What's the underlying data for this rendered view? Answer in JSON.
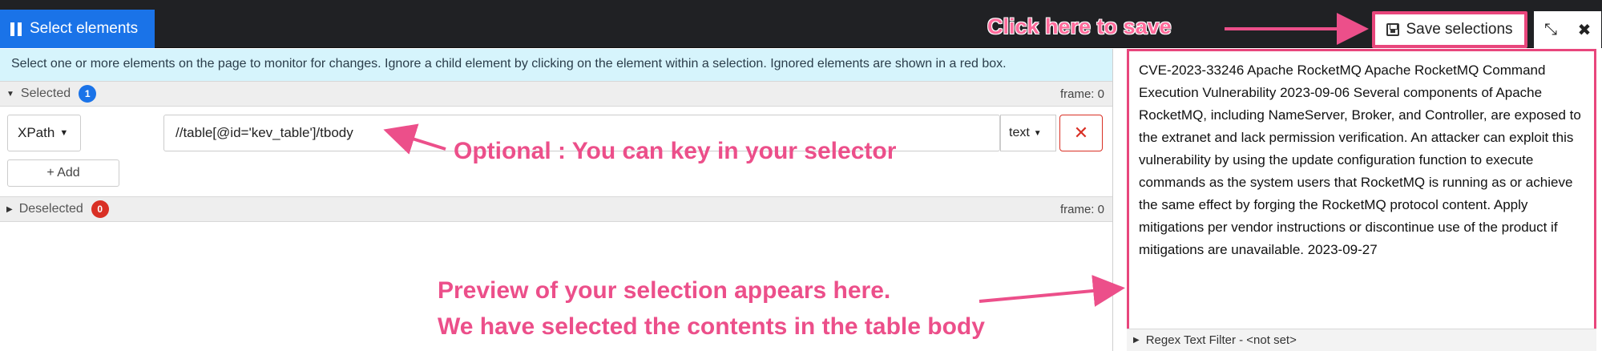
{
  "toolbar": {
    "select_label": "Select elements",
    "save_label": "Save selections",
    "collapse_glyph": "⤡",
    "close_glyph": "✖"
  },
  "info_text": "Select one or more elements on the page to monitor for changes. Ignore a child element by clicking on the element within a selection. Ignored elements are shown in a red box.",
  "selected": {
    "label": "Selected",
    "count": "1",
    "frame": "frame: 0",
    "rows": [
      {
        "type": "XPath",
        "selector": "//table[@id='kev_table']/tbody",
        "mode": "text"
      }
    ],
    "add_label": "+ Add",
    "remove_glyph": "✕"
  },
  "deselected": {
    "label": "Deselected",
    "count": "0",
    "frame": "frame: 0"
  },
  "preview": {
    "text": "CVE-2023-33246 Apache RocketMQ Apache RocketMQ Command Execution Vulnerability 2023-09-06 Several components of Apache RocketMQ, including NameServer, Broker, and Controller, are exposed to the extranet and lack permission verification. An attacker can exploit this vulnerability by using the update configuration function to execute commands as the system users that RocketMQ is running as or achieve the same effect by forging the RocketMQ protocol content. Apply mitigations per vendor instructions or discontinue use of the product if mitigations are unavailable. 2023-09-27",
    "regex_label": "Regex Text Filter - <not set>"
  },
  "annotations": {
    "save": "Click here to save",
    "optional": "Optional : You can key in your selector",
    "preview_line1": "Preview of your selection appears here.",
    "preview_line2": "We have selected the contents in the table body"
  },
  "colors": {
    "accent_blue": "#1a73e8",
    "annotation_pink": "#e8467c",
    "info_bg": "#d6f4fc",
    "danger_red": "#d93025"
  }
}
